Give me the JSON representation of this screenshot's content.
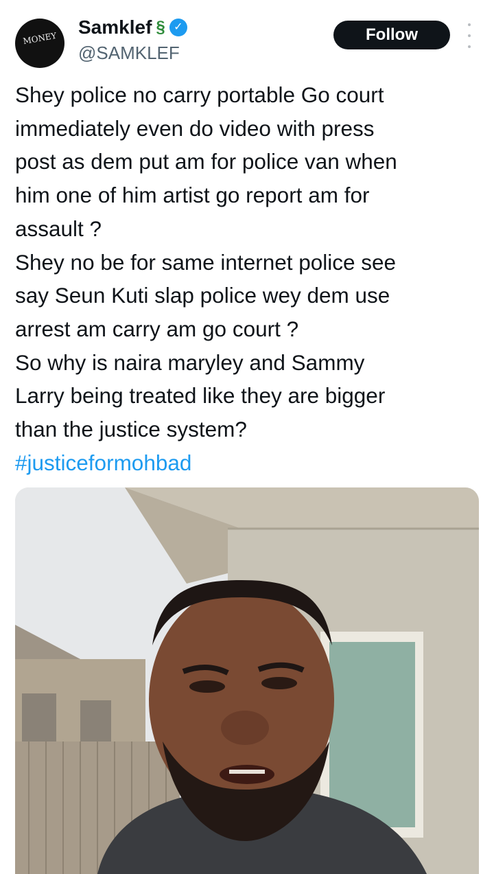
{
  "author": {
    "display_name": "Samklef",
    "handle": "@SAMKLEF",
    "avatar_logo_text": "MONEY",
    "name_emoji": "snake-icon",
    "verified_icon": "verified-badge-icon"
  },
  "actions": {
    "follow_label": "Follow",
    "more_icon": "more-options-icon"
  },
  "tweet": {
    "lines": [
      "Shey police no carry portable Go court",
      "immediately even do video with press",
      "post as dem put am for police van when",
      "him one of him artist go report am for",
      "assault ?",
      "Shey no be for same internet police see",
      "say Seun Kuti slap police wey dem use",
      "arrest am carry am go court ?",
      "So why is naira maryley and Sammy",
      "Larry being treated like they are bigger",
      "than the justice system?"
    ],
    "hashtag": "#justiceformohbad"
  },
  "media": {
    "type": "video-frame",
    "description_icon": "video-thumbnail"
  },
  "colors": {
    "text": "#0f1419",
    "secondary": "#536471",
    "accent": "#1d9bf0",
    "button_bg": "#0f1419"
  }
}
